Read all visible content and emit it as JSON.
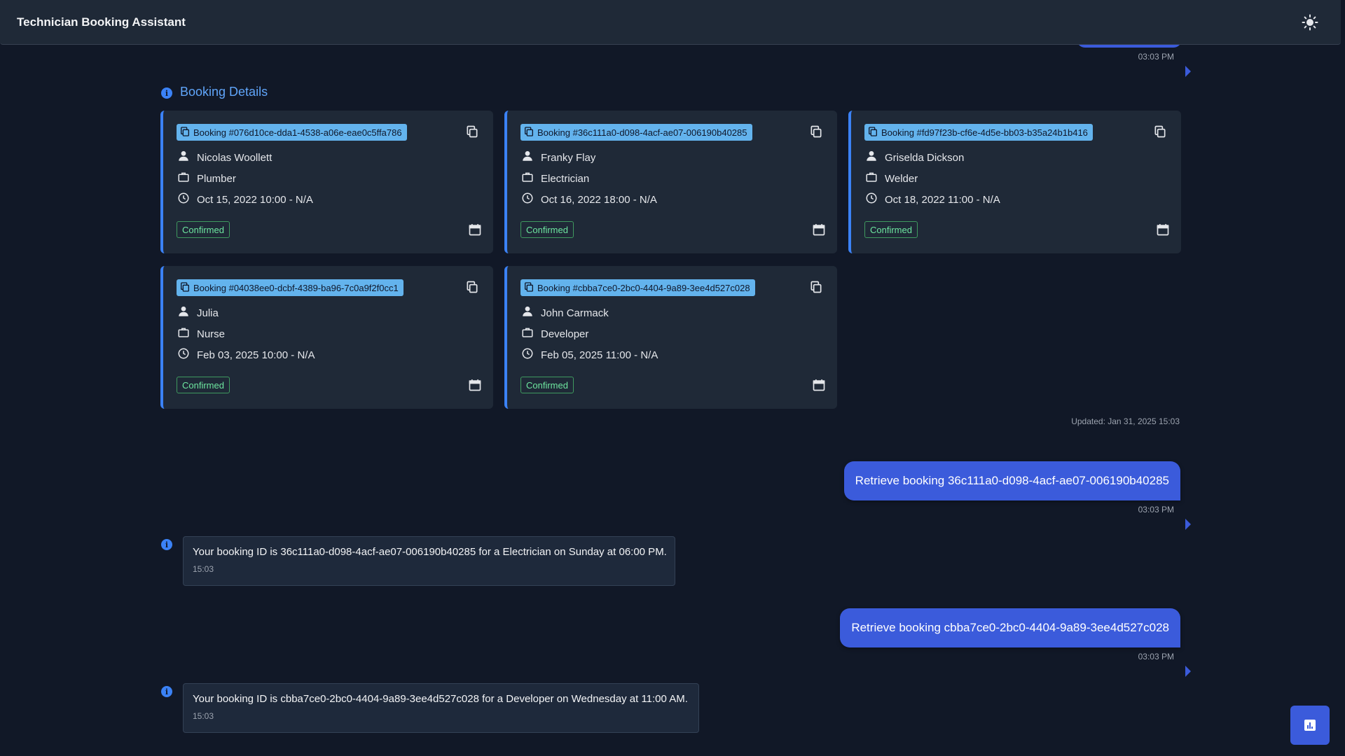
{
  "header": {
    "title": "Technician Booking Assistant",
    "theme_icon": "sun-icon"
  },
  "timestamps": {
    "top": "03:03 PM",
    "msg1": "03:03 PM",
    "msg2": "03:03 PM"
  },
  "section": {
    "title": "Booking Details",
    "updated": "Updated: Jan 31, 2025 15:03"
  },
  "bookings": [
    {
      "id_label": "Booking #076d10ce-dda1-4538-a06e-eae0c5ffa786",
      "name": "Nicolas Woollett",
      "role": "Plumber",
      "time": "Oct 15, 2022 10:00 - N/A",
      "status": "Confirmed"
    },
    {
      "id_label": "Booking #36c111a0-d098-4acf-ae07-006190b40285",
      "name": "Franky Flay",
      "role": "Electrician",
      "time": "Oct 16, 2022 18:00 - N/A",
      "status": "Confirmed"
    },
    {
      "id_label": "Booking #fd97f23b-cf6e-4d5e-bb03-b35a24b1b416",
      "name": "Griselda Dickson",
      "role": "Welder",
      "time": "Oct 18, 2022 11:00 - N/A",
      "status": "Confirmed"
    },
    {
      "id_label": "Booking #04038ee0-dcbf-4389-ba96-7c0a9f2f0cc1",
      "name": "Julia",
      "role": "Nurse",
      "time": "Feb 03, 2025 10:00 - N/A",
      "status": "Confirmed"
    },
    {
      "id_label": "Booking #cbba7ce0-2bc0-4404-9a89-3ee4d527c028",
      "name": "John Carmack",
      "role": "Developer",
      "time": "Feb 05, 2025 11:00 - N/A",
      "status": "Confirmed"
    }
  ],
  "messages": [
    {
      "role": "user",
      "text": "Retrieve booking 36c111a0-d098-4acf-ae07-006190b40285",
      "time": "03:03 PM"
    },
    {
      "role": "assistant",
      "text": "Your booking ID is 36c111a0-d098-4acf-ae07-006190b40285 for a Electrician on Sunday at 06:00 PM.",
      "time": "15:03"
    },
    {
      "role": "user",
      "text": "Retrieve booking cbba7ce0-2bc0-4404-9a89-3ee4d527c028",
      "time": "03:03 PM"
    },
    {
      "role": "assistant",
      "text": "Your booking ID is cbba7ce0-2bc0-4404-9a89-3ee4d527c028 for a Developer on Wednesday at 11:00 AM.",
      "time": "15:03"
    }
  ],
  "icons": {
    "info": "info-icon",
    "copy": "copy-icon",
    "person": "person-icon",
    "briefcase": "briefcase-icon",
    "clock": "clock-icon",
    "calendar": "calendar-icon",
    "fab": "chart-icon"
  },
  "colors": {
    "background": "#111827",
    "accent": "#3b5bdb",
    "tag": "#63b3ed",
    "status": "#4ade80"
  }
}
